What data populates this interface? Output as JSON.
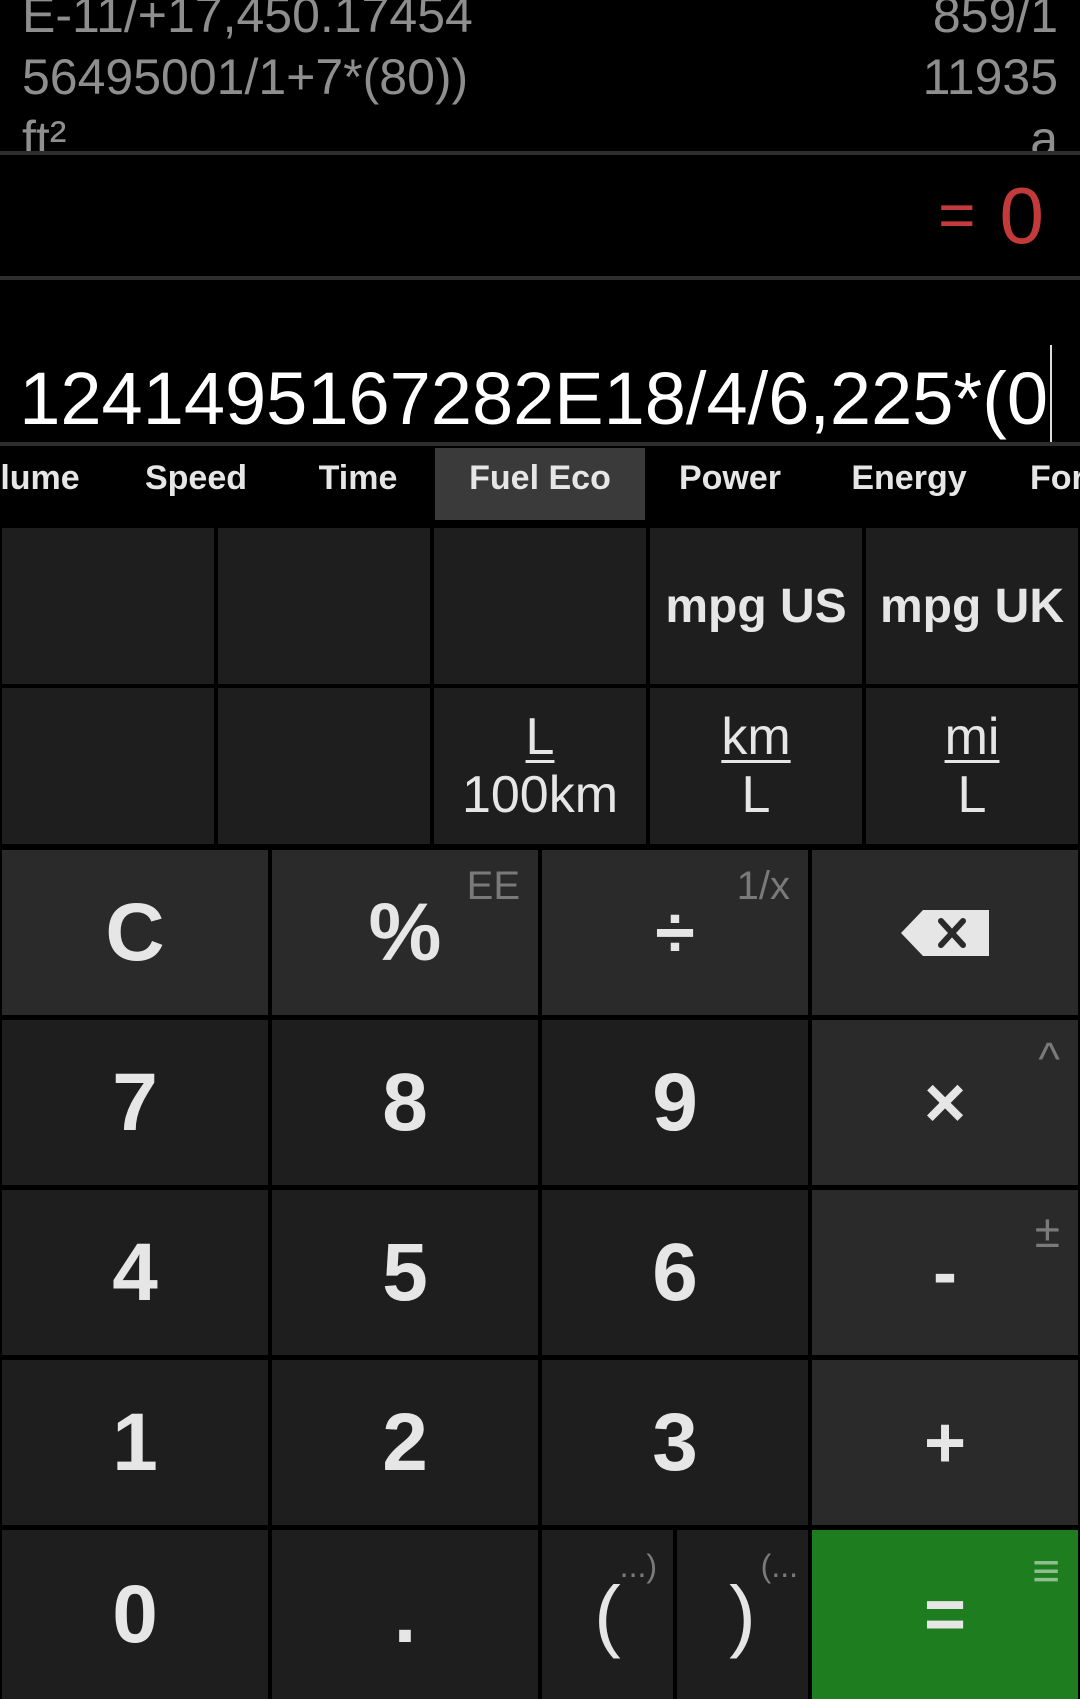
{
  "history": {
    "lines": [
      {
        "expr": "E-11/+17,450.17454",
        "result": "859/1"
      },
      {
        "expr": "56495001/1+7*(80))",
        "result": "11935"
      },
      {
        "expr": "ft²",
        "result": "a"
      }
    ]
  },
  "result": {
    "prefix": "=",
    "value": "0"
  },
  "expression": "1241495167282E18/4/6,225*(0",
  "tabs": [
    "lume",
    "Speed",
    "Time",
    "Fuel Eco",
    "Power",
    "Energy",
    "For"
  ],
  "active_tab": "Fuel Eco",
  "units": {
    "mpg_us": "mpg US",
    "mpg_uk": "mpg UK",
    "l_per_100km": {
      "num": "L",
      "den": "100km"
    },
    "km_per_l": {
      "num": "km",
      "den": "L"
    },
    "mi_per_l": {
      "num": "mi",
      "den": "L"
    }
  },
  "keys": {
    "clear": "C",
    "percent": "%",
    "percent_sub": "EE",
    "divide": "÷",
    "divide_sub": "1/x",
    "seven": "7",
    "eight": "8",
    "nine": "9",
    "multiply": "×",
    "multiply_sub": "^",
    "four": "4",
    "five": "5",
    "six": "6",
    "minus": "-",
    "minus_sub": "±",
    "one": "1",
    "two": "2",
    "three": "3",
    "plus": "+",
    "zero": "0",
    "dot": ".",
    "open_paren": "(",
    "open_paren_sub": "...)",
    "close_paren": ")",
    "close_paren_sub": "(...",
    "equals": "=",
    "equals_sub": "≡"
  },
  "colors": {
    "result": "#c23a3a",
    "equals_key": "#1e7d1e",
    "background": "#000000",
    "key": "#1e1e1e"
  }
}
